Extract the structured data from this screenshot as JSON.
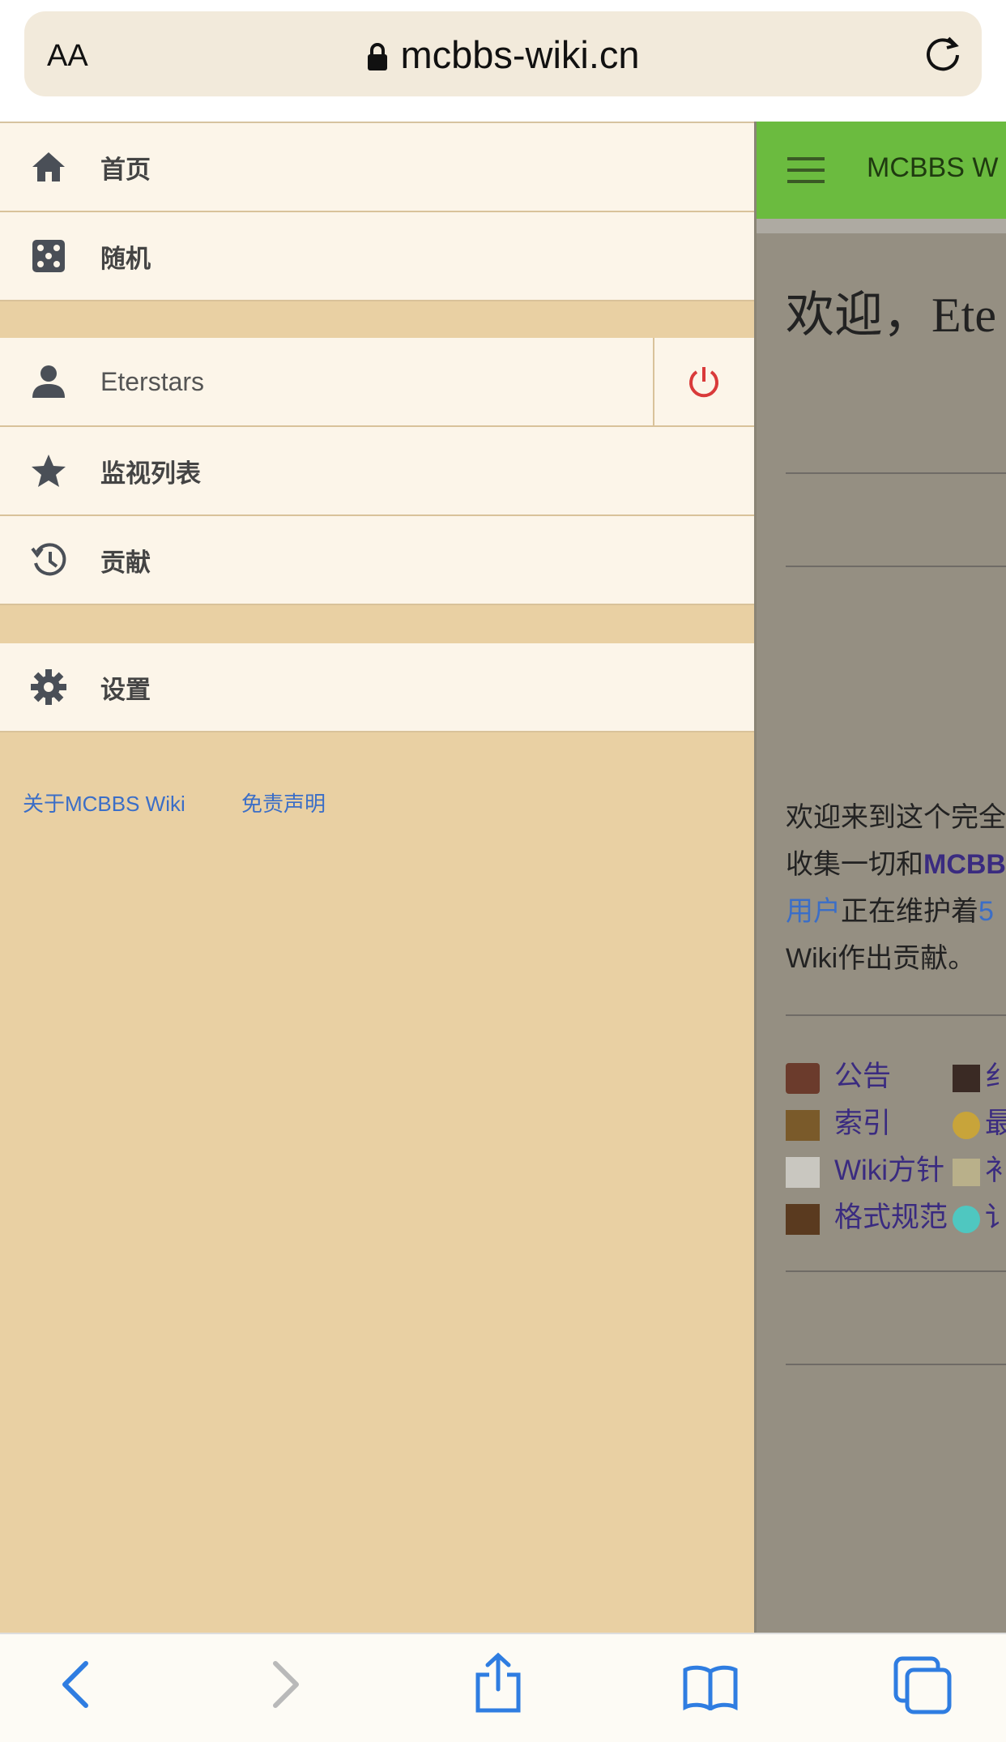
{
  "browser": {
    "aa_label": "AA",
    "url": "mcbbs-wiki.cn"
  },
  "sidebar": {
    "items": [
      {
        "label": "首页",
        "icon": "home-icon"
      },
      {
        "label": "随机",
        "icon": "dice-icon"
      },
      {
        "label": "Eterstars",
        "icon": "user-icon"
      },
      {
        "label": "监视列表",
        "icon": "star-icon"
      },
      {
        "label": "贡献",
        "icon": "history-icon"
      },
      {
        "label": "设置",
        "icon": "gear-icon"
      }
    ],
    "footer_links": [
      "关于MCBBS Wiki",
      "免责声明"
    ]
  },
  "content": {
    "site_title": "MCBBS W",
    "welcome": "欢迎，Ete",
    "paragraph": {
      "line1": "欢迎来到这个完全",
      "line2_a": "收集一切和",
      "line2_b": "MCBB",
      "line3_a": "用户",
      "line3_b": "正在维护着",
      "line3_c": "5",
      "line4": "Wiki作出贡献。"
    },
    "nav": [
      "公告",
      "索引",
      "Wiki方针",
      "格式规范"
    ],
    "nav_right": [
      "纟",
      "最",
      "衤",
      "讠"
    ]
  },
  "colors": {
    "accent_green": "#6bbb3f",
    "sidebar_bg": "#e9d0a3",
    "item_bg": "#fcf5e9",
    "logout_red": "#d93a3a",
    "link_blue": "#3b6ec7"
  }
}
